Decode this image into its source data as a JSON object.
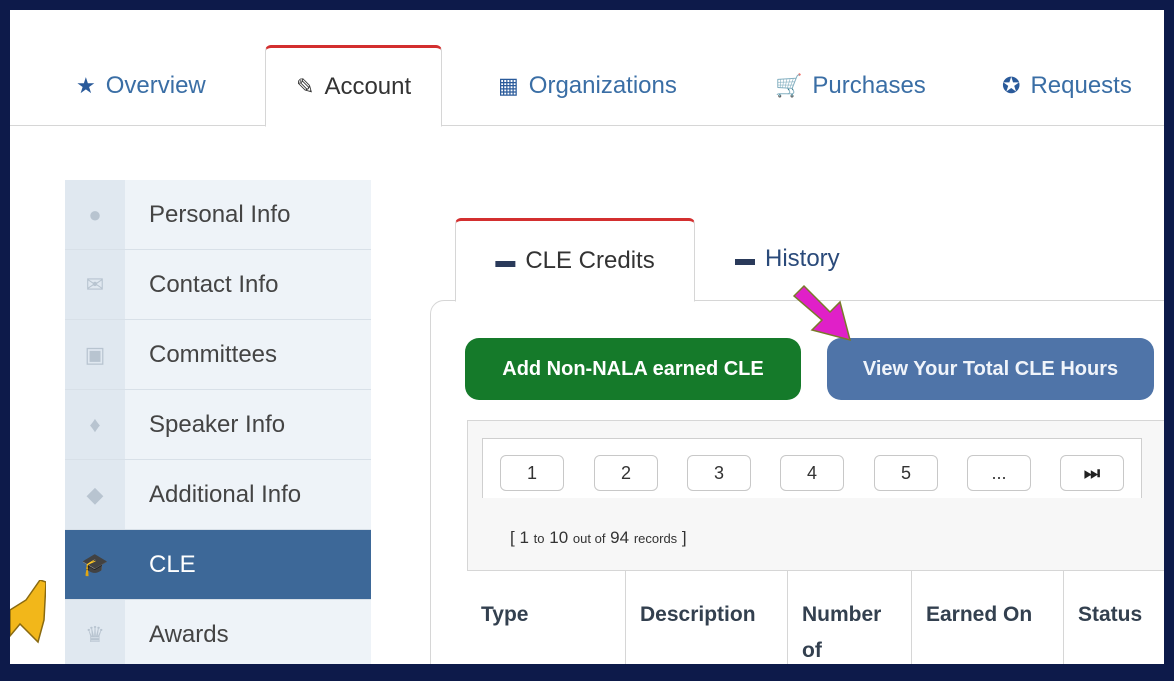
{
  "colors": {
    "accent": "#3d6898",
    "tab_active_border": "#d32f2f",
    "add_button": "#157a2a",
    "view_button": "#4f74a8",
    "frame": "#0d1a4a",
    "pink_arrow": "#e020c8",
    "gold_arrow": "#f2b71a"
  },
  "top_tabs": [
    {
      "label": "Overview",
      "icon": "star-icon"
    },
    {
      "label": "Account",
      "icon": "edit-icon"
    },
    {
      "label": "Organizations",
      "icon": "building-icon"
    },
    {
      "label": "Purchases",
      "icon": "cart-icon"
    },
    {
      "label": "Requests",
      "icon": "lifering-icon"
    }
  ],
  "sidebar": {
    "items": [
      {
        "label": "Personal Info",
        "icon": "user-icon"
      },
      {
        "label": "Contact Info",
        "icon": "envelope-icon"
      },
      {
        "label": "Committees",
        "icon": "briefcase-icon"
      },
      {
        "label": "Speaker Info",
        "icon": "microphone-icon"
      },
      {
        "label": "Additional Info",
        "icon": "tags-icon"
      },
      {
        "label": "CLE",
        "icon": "graduation-cap-icon"
      },
      {
        "label": "Awards",
        "icon": "trophy-icon"
      }
    ]
  },
  "sub_tabs": [
    {
      "label": "CLE Credits",
      "icon": "ticket-icon"
    },
    {
      "label": "History",
      "icon": "ticket-icon"
    }
  ],
  "buttons": {
    "add": "Add Non-NALA earned CLE",
    "view": "View Your Total CLE Hours"
  },
  "pager": {
    "pages": [
      "1",
      "2",
      "3",
      "4",
      "5",
      "..."
    ],
    "last_icon": "skip-last-icon"
  },
  "records": {
    "open": "[",
    "from": "1",
    "to_word": "to",
    "to": "10",
    "out_of_word": "out of",
    "total": "94",
    "records_word": "records",
    "close": "]"
  },
  "table": {
    "columns": [
      "Type",
      "Description",
      "Number of",
      "Earned On",
      "Status"
    ]
  }
}
